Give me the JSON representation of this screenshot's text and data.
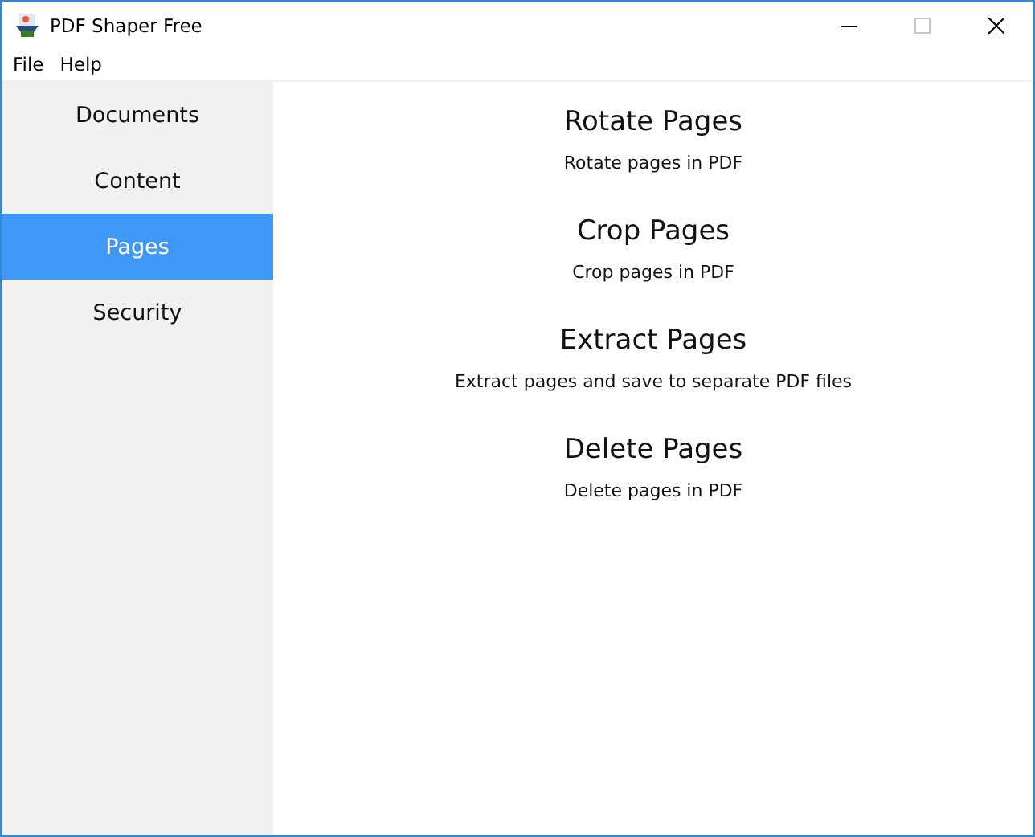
{
  "window": {
    "title": "PDF Shaper Free",
    "maximize_disabled": true
  },
  "menu": [
    "File",
    "Help"
  ],
  "sidebar": {
    "items": [
      {
        "label": "Documents",
        "selected": false
      },
      {
        "label": "Content",
        "selected": false
      },
      {
        "label": "Pages",
        "selected": true
      },
      {
        "label": "Security",
        "selected": false
      }
    ]
  },
  "actions": [
    {
      "title": "Rotate Pages",
      "description": "Rotate pages in PDF"
    },
    {
      "title": "Crop Pages",
      "description": "Crop pages in PDF"
    },
    {
      "title": "Extract Pages",
      "description": "Extract pages and save to separate PDF files"
    },
    {
      "title": "Delete Pages",
      "description": "Delete pages in PDF"
    }
  ]
}
